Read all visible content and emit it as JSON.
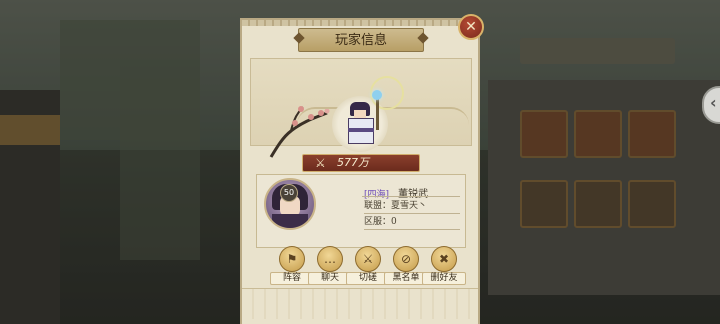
{
  "dialog": {
    "title": "玩家信息",
    "close_icon": "close-icon"
  },
  "power": {
    "icon": "crossed-swords-icon",
    "value": "577万"
  },
  "player": {
    "level": "50",
    "server_tag": "[四海]",
    "name": "董锐武",
    "alliance_line": "联盟：夏雪天丶",
    "server_line": "区服：0"
  },
  "actions": [
    {
      "label": "阵容",
      "icon": "flag-icon"
    },
    {
      "label": "聊天",
      "icon": "chat-icon"
    },
    {
      "label": "切磋",
      "icon": "crossed-swords-icon"
    },
    {
      "label": "黑名单",
      "icon": "blacklist-icon"
    },
    {
      "label": "删好友",
      "icon": "remove-friend-icon"
    }
  ],
  "colors": {
    "panel": "#e9e2cc",
    "power_bar": "#8a3f2c",
    "server_tag": "#6b49b8",
    "button_gold": "#d9b563"
  }
}
